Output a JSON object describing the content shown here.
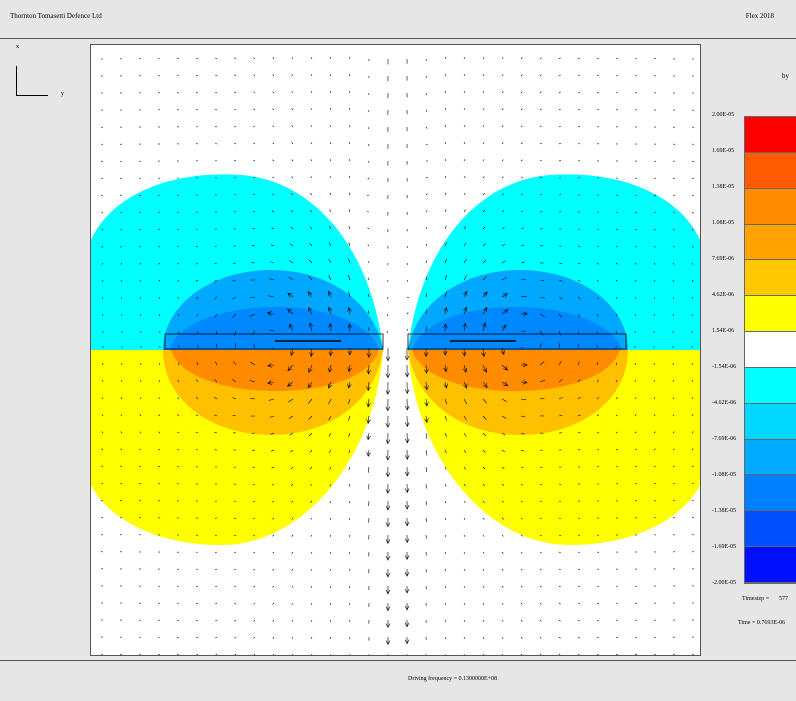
{
  "header": {
    "left_title": "Thornton Tomasetti Defence Ltd",
    "right_title": "Flex  2018"
  },
  "axis_indicator": {
    "x_label": "x",
    "y_label": "y"
  },
  "legend": {
    "title": "by",
    "labels": [
      "2.00E-05",
      "1.69E-05",
      "1.38E-05",
      "1.08E-05",
      "7.69E-06",
      "4.62E-06",
      "1.54E-06",
      "-1.54E-06",
      "-4.62E-06",
      "-7.69E-06",
      "-1.08E-05",
      "-1.38E-05",
      "-1.69E-05",
      "-2.00E-05"
    ],
    "colors": [
      "#ff0000",
      "#ff5a00",
      "#ff8c00",
      "#ffa300",
      "#ffc800",
      "#ffff00",
      "#ffffff",
      "#00ffff",
      "#00d8ff",
      "#00aaff",
      "#0080ff",
      "#0050ff",
      "#0010ff"
    ]
  },
  "status": {
    "timestep_label": "Timestep =",
    "timestep_value": "577",
    "time_label": "Time = 0.7693E-06"
  },
  "footer": {
    "driving_frequency": "Driving frequency = 0.1300000E+08"
  },
  "palette": {
    "cyan": "#00ffff",
    "light_blue": "#00a8ff",
    "blue": "#0088ff",
    "yellow": "#ffff00",
    "orange": "#ffc000",
    "deep_orange": "#ff8c00"
  }
}
